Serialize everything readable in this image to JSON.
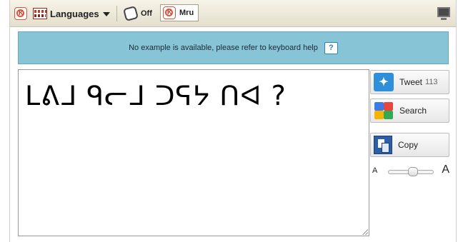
{
  "toolbar": {
    "languages_label": "Languages",
    "off_label": "Off",
    "mru_label": "Mru",
    "mru_icon_letter": "K"
  },
  "banner": {
    "text": "No example is available, please refer to keyboard help",
    "help_label": "?"
  },
  "editor": {
    "text": "ᒪᕕᒧ ᑫᓕᒧ ᑐᕋᔭ ᑎᐊ ?"
  },
  "side": {
    "tweet_label": "Tweet",
    "tweet_count": "113",
    "search_label": "Search",
    "copy_label": "Copy",
    "font_small": "A",
    "font_large": "A",
    "font_size_level": 0.6
  },
  "colors": {
    "banner_bg": "#87c4d6",
    "toolbar_bg": "#ebe6d6",
    "twitter_blue": "#2f8fd8"
  },
  "icons": {
    "app": "keyman-icon",
    "keyboard": "keyboard-icon",
    "off": "off-keyboard-icon",
    "display": "monitor-icon",
    "help": "help-icon",
    "tweet": "twitter-icon",
    "search": "google-icon",
    "copy": "copy-icon"
  }
}
